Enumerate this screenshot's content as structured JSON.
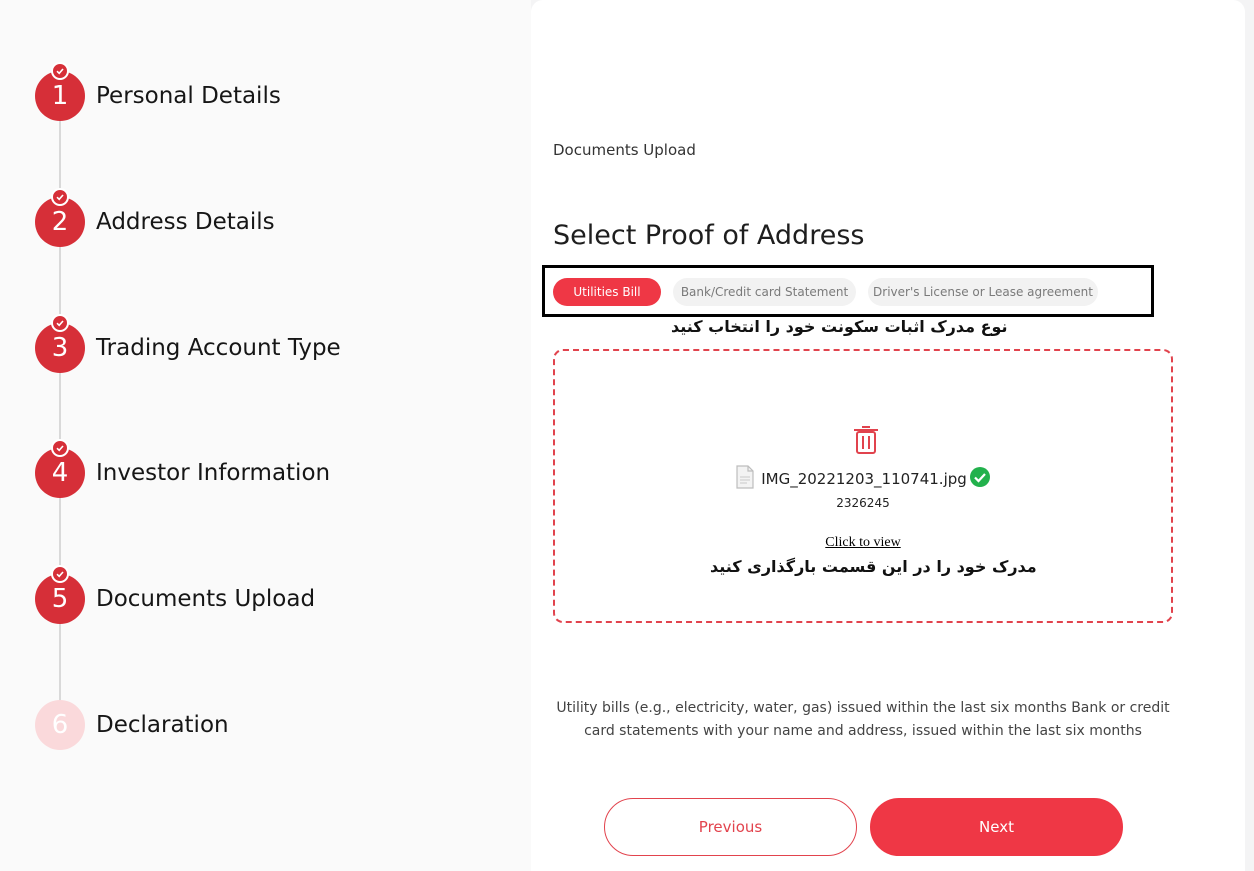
{
  "steps": [
    {
      "number": "1",
      "label": "Personal Details",
      "status": "done"
    },
    {
      "number": "2",
      "label": "Address Details",
      "status": "done"
    },
    {
      "number": "3",
      "label": "Trading Account Type",
      "status": "done"
    },
    {
      "number": "4",
      "label": "Investor Information",
      "status": "done"
    },
    {
      "number": "5",
      "label": "Documents Upload",
      "status": "done"
    },
    {
      "number": "6",
      "label": "Declaration",
      "status": "pending"
    }
  ],
  "main": {
    "breadcrumb": "Documents Upload",
    "title": "Select Proof of Address",
    "options": [
      {
        "label": "Utilities Bill",
        "selected": true
      },
      {
        "label": "Bank/Credit card Statement",
        "selected": false
      },
      {
        "label": "Driver's License or Lease agreement",
        "selected": false
      }
    ],
    "annotation_select": "نوع مدرک اثبات سکونت خود را انتخاب کنید",
    "upload": {
      "file_name": "IMG_20221203_110741.jpg",
      "file_size": "2326245",
      "view_link": "Click to view",
      "annotation_upload": "مدرک خود را در این قسمت بارگذاری کنید"
    },
    "help_text": "Utility bills (e.g., electricity, water, gas) issued within the last six months Bank or credit card statements with your name and address, issued within the last six months",
    "buttons": {
      "previous": "Previous",
      "next": "Next"
    }
  },
  "colors": {
    "accent": "#ef3745",
    "step_done": "#d62f38",
    "step_pending": "#fad9db",
    "success": "#22b14c"
  },
  "icons": [
    "check-icon",
    "trash-icon",
    "file-icon",
    "check-circle-icon"
  ]
}
